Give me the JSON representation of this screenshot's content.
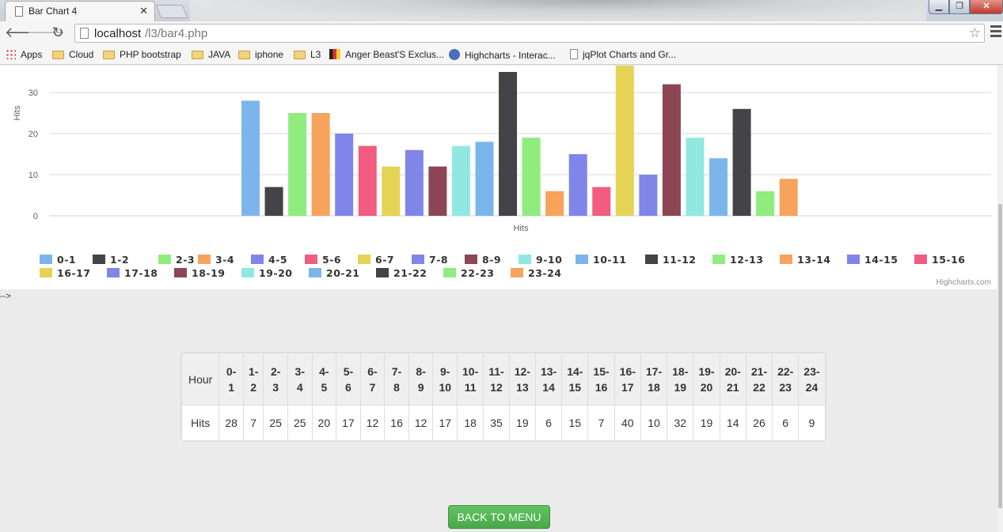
{
  "browser": {
    "tab_title": "Bar Chart 4",
    "url_host": "localhost",
    "url_path": "/l3/bar4.php",
    "bookmarks": [
      {
        "label": "Apps",
        "icon": "apps-icon"
      },
      {
        "label": "Cloud",
        "icon": "folder-icon"
      },
      {
        "label": "PHP bootstrap",
        "icon": "folder-icon"
      },
      {
        "label": "JAVA",
        "icon": "folder-icon"
      },
      {
        "label": "iphone",
        "icon": "folder-icon"
      },
      {
        "label": "L3",
        "icon": "folder-icon"
      },
      {
        "label": "Anger Beast'S Exclus...",
        "icon": "site-icon"
      },
      {
        "label": "Highcharts - Interac...",
        "icon": "highcharts-icon"
      },
      {
        "label": "jqPlot Charts and Gr...",
        "icon": "page-icon"
      }
    ]
  },
  "chart_data": {
    "type": "bar",
    "title": "",
    "xlabel": "Hits",
    "ylabel": "Hits",
    "ylim": [
      0,
      40
    ],
    "yticks": [
      0,
      10,
      20,
      30
    ],
    "grid": true,
    "legend_position": "bottom",
    "credit": "Highcharts.com",
    "series": [
      {
        "name": "0-1",
        "value": 28,
        "color": "#7cb5ec"
      },
      {
        "name": "1-2",
        "value": 7,
        "color": "#434348"
      },
      {
        "name": "2-3",
        "value": 25,
        "color": "#90ed7d"
      },
      {
        "name": "3-4",
        "value": 25,
        "color": "#f7a35c"
      },
      {
        "name": "4-5",
        "value": 20,
        "color": "#8085e9"
      },
      {
        "name": "5-6",
        "value": 17,
        "color": "#f15c80"
      },
      {
        "name": "6-7",
        "value": 12,
        "color": "#e4d354"
      },
      {
        "name": "7-8",
        "value": 16,
        "color": "#8085e8"
      },
      {
        "name": "8-9",
        "value": 12,
        "color": "#8d4653"
      },
      {
        "name": "9-10",
        "value": 17,
        "color": "#91e8e1"
      },
      {
        "name": "10-11",
        "value": 18,
        "color": "#7cb5ec"
      },
      {
        "name": "11-12",
        "value": 35,
        "color": "#434348"
      },
      {
        "name": "12-13",
        "value": 19,
        "color": "#90ed7d"
      },
      {
        "name": "13-14",
        "value": 6,
        "color": "#f7a35c"
      },
      {
        "name": "14-15",
        "value": 15,
        "color": "#8085e9"
      },
      {
        "name": "15-16",
        "value": 7,
        "color": "#f15c80"
      },
      {
        "name": "16-17",
        "value": 40,
        "color": "#e4d354"
      },
      {
        "name": "17-18",
        "value": 10,
        "color": "#8085e8"
      },
      {
        "name": "18-19",
        "value": 32,
        "color": "#8d4653"
      },
      {
        "name": "19-20",
        "value": 19,
        "color": "#91e8e1"
      },
      {
        "name": "20-21",
        "value": 14,
        "color": "#7cb5ec"
      },
      {
        "name": "21-22",
        "value": 26,
        "color": "#434348"
      },
      {
        "name": "22-23",
        "value": 6,
        "color": "#90ed7d"
      },
      {
        "name": "23-24",
        "value": 9,
        "color": "#f7a35c"
      }
    ]
  },
  "stray_text": "-->",
  "table": {
    "row_header_hour": "Hour",
    "row_header_hits": "Hits",
    "hours": [
      "0-1",
      "1-2",
      "2-3",
      "3-4",
      "4-5",
      "5-6",
      "6-7",
      "7-8",
      "8-9",
      "9-10",
      "10-11",
      "11-12",
      "12-13",
      "13-14",
      "14-15",
      "15-16",
      "16-17",
      "17-18",
      "18-19",
      "19-20",
      "20-21",
      "21-22",
      "22-23",
      "23-24"
    ],
    "hits": [
      "28",
      "7",
      "25",
      "25",
      "20",
      "17",
      "12",
      "16",
      "12",
      "17",
      "18",
      "35",
      "19",
      "6",
      "15",
      "7",
      "40",
      "10",
      "32",
      "19",
      "14",
      "26",
      "6",
      "9"
    ]
  },
  "back_button_label": "BACK TO MENU"
}
